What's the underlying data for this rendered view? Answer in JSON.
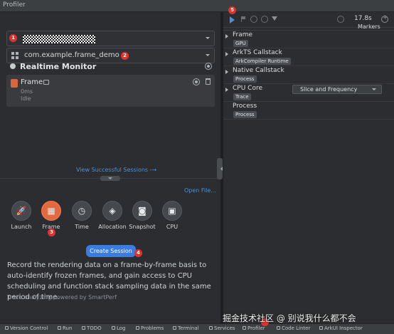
{
  "window": {
    "title": "Profiler"
  },
  "target": {
    "device_value_redacted": true,
    "app_value": "com.example.frame_demo"
  },
  "monitor": {
    "title": "Realtime Monitor",
    "session": {
      "name": "Frame",
      "duration": "0ms",
      "state": "Idle"
    },
    "view_link": "View Successful Sessions -→"
  },
  "launcher": {
    "open_file": "Open File...",
    "tools": [
      {
        "label": "Launch",
        "icon": "rocket-icon",
        "glyph": "🚀"
      },
      {
        "label": "Frame",
        "icon": "frame-icon",
        "glyph": "▦"
      },
      {
        "label": "Time",
        "icon": "clock-icon",
        "glyph": "◷"
      },
      {
        "label": "Allocation",
        "icon": "cube-icon",
        "glyph": "◈"
      },
      {
        "label": "Snapshot",
        "icon": "camera-icon",
        "glyph": "◙"
      },
      {
        "label": "CPU",
        "icon": "chip-icon",
        "glyph": "▣"
      }
    ],
    "active_tool": "Frame",
    "create_button": "Create Session",
    "description": "Record the rendering data on a frame-by-frame basis to auto-identify frozen frames, and gain access to CPU scheduling and function stack sampling data in the same period of time.",
    "powered_by": "Trace analyzing powered by SmartPerf"
  },
  "timeline": {
    "time": "17.8s",
    "markers_label": "Markers",
    "lanes": [
      {
        "name": "Frame",
        "tag": "GPU"
      },
      {
        "name": "ArkTS Callstack",
        "tag": "ArkCompiler Runtime"
      },
      {
        "name": "Native Callstack",
        "tag": "Process"
      },
      {
        "name": "CPU Core",
        "tag": "Trace",
        "dropdown": "Slice and Frequency"
      },
      {
        "name": "Process",
        "tag": "Process"
      }
    ]
  },
  "annotations": {
    "b1": "1",
    "b2": "2",
    "b3": "3",
    "b4": "4",
    "b5": "5"
  },
  "statusbar": {
    "items": [
      "Version Control",
      "Run",
      "TODO",
      "Log",
      "Problems",
      "Terminal",
      "Services",
      "Profiler",
      "Code Linter",
      "ArkUI Inspector"
    ]
  },
  "watermark": "掘金技术社区 @ 别说我什么都不会",
  "colors": {
    "accent": "#3a7ce0",
    "active_tool": "#e2693e",
    "badge": "#e0322c"
  }
}
